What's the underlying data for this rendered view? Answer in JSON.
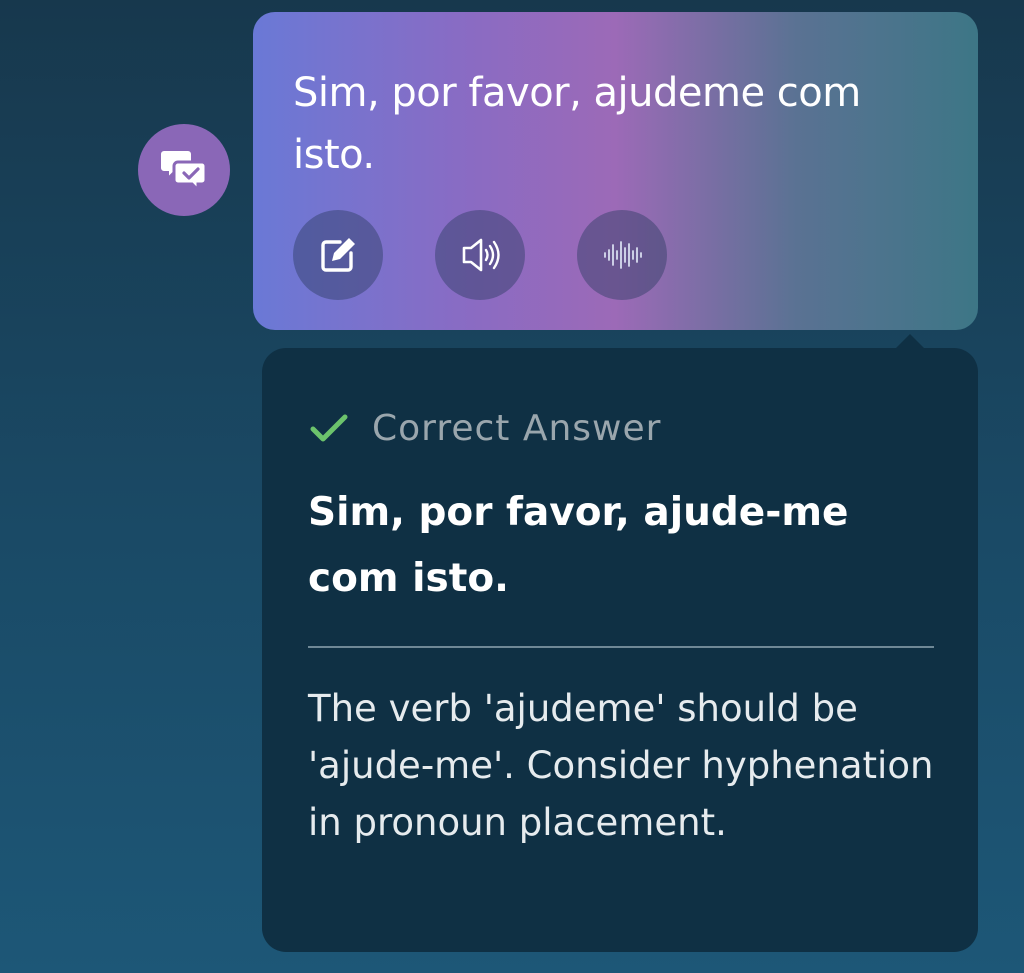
{
  "message": {
    "text": "Sim, por favor, ajudeme com isto.",
    "avatar_icon": "chat-check-icon",
    "actions": [
      {
        "name": "edit",
        "icon": "edit-icon"
      },
      {
        "name": "speaker",
        "icon": "speaker-icon"
      },
      {
        "name": "waveform",
        "icon": "waveform-icon"
      }
    ]
  },
  "feedback": {
    "status_label": "Correct Answer",
    "status_icon": "check-icon",
    "status_color": "#6cc36c",
    "correct_text": "Sim, por favor, ajude-me com isto.",
    "explanation": "The verb 'ajudeme' should be 'ajude-me'. Consider hyphenation in pronoun placement."
  }
}
